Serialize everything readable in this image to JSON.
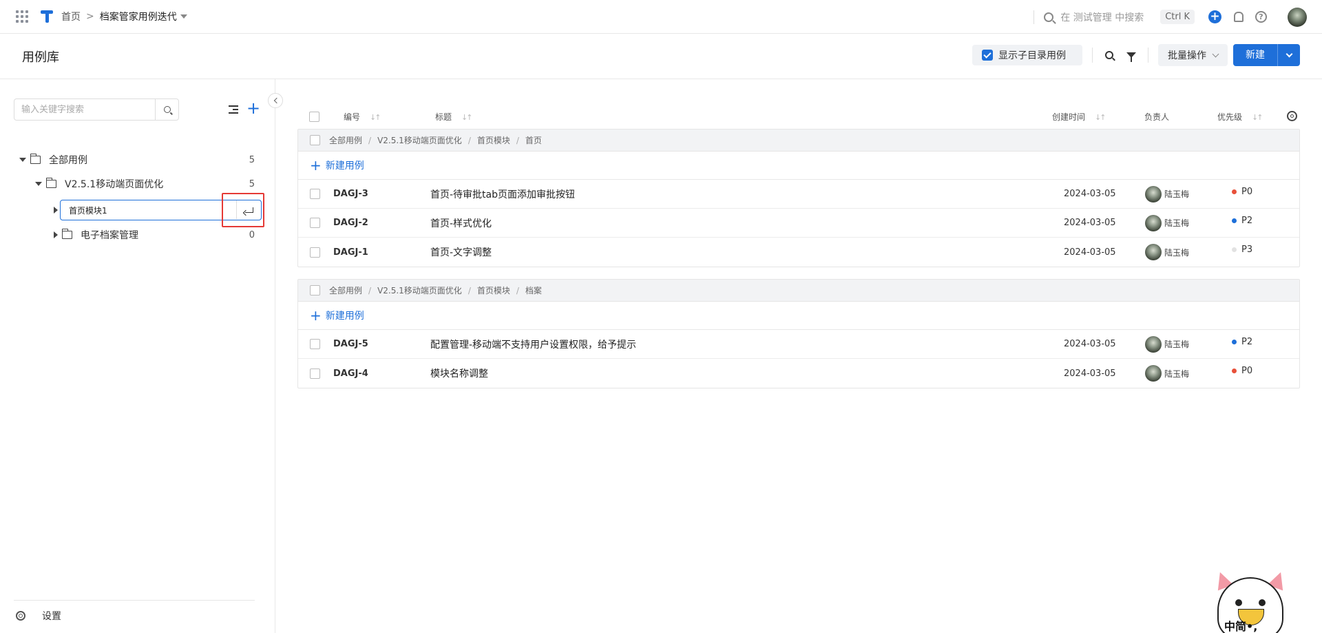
{
  "topnav": {
    "breadcrumb_home": "首页",
    "breadcrumb_sep": ">",
    "project_name": "档案管家用例迭代",
    "search_placeholder": "在 测试管理 中搜索",
    "search_shortcut": "Ctrl K",
    "plus_label": "+",
    "help_label": "?"
  },
  "page": {
    "title": "用例库",
    "show_sub_label": "显示子目录用例",
    "show_sub_checked": true,
    "batch_label": "批量操作",
    "new_label": "新建"
  },
  "sidebar": {
    "search_placeholder": "输入关键字搜索",
    "add_label": "+",
    "tree": {
      "root": {
        "label": "全部用例",
        "count": "5"
      },
      "iteration": {
        "label": "V2.5.1移动端页面优化",
        "count": "5"
      },
      "editing_value": "首页模块1",
      "electronic": {
        "label": "电子档案管理",
        "count": "0"
      }
    },
    "settings_label": "设置"
  },
  "table": {
    "columns": {
      "id": "编号",
      "title": "标题",
      "created": "创建时间",
      "owner": "负责人",
      "priority": "优先级"
    },
    "sort_glyph": "↓↑",
    "add_case_label": "新建用例",
    "groups": [
      {
        "path": [
          "全部用例",
          "V2.5.1移动端页面优化",
          "首页模块",
          "首页"
        ],
        "rows": [
          {
            "id": "DAGJ-3",
            "title": "首页-待审批tab页面添加审批按钮",
            "date": "2024-03-05",
            "owner": "陆玉梅",
            "priority": "P0",
            "priority_color": "#e8503a"
          },
          {
            "id": "DAGJ-2",
            "title": "首页-样式优化",
            "date": "2024-03-05",
            "owner": "陆玉梅",
            "priority": "P2",
            "priority_color": "#1e6fd9"
          },
          {
            "id": "DAGJ-1",
            "title": "首页-文字调整",
            "date": "2024-03-05",
            "owner": "陆玉梅",
            "priority": "P3",
            "priority_color": "#e2e2e2"
          }
        ]
      },
      {
        "path": [
          "全部用例",
          "V2.5.1移动端页面优化",
          "首页模块",
          "档案"
        ],
        "rows": [
          {
            "id": "DAGJ-5",
            "title": "配置管理-移动端不支持用户设置权限，给予提示",
            "date": "2024-03-05",
            "owner": "陆玉梅",
            "priority": "P2",
            "priority_color": "#1e6fd9"
          },
          {
            "id": "DAGJ-4",
            "title": "模块名称调整",
            "date": "2024-03-05",
            "owner": "陆玉梅",
            "priority": "P0",
            "priority_color": "#e8503a"
          }
        ]
      }
    ]
  },
  "mascot": {
    "text": "中简•,"
  },
  "colors": {
    "accent": "#1e6fd9",
    "highlight_box": "#e53935"
  }
}
